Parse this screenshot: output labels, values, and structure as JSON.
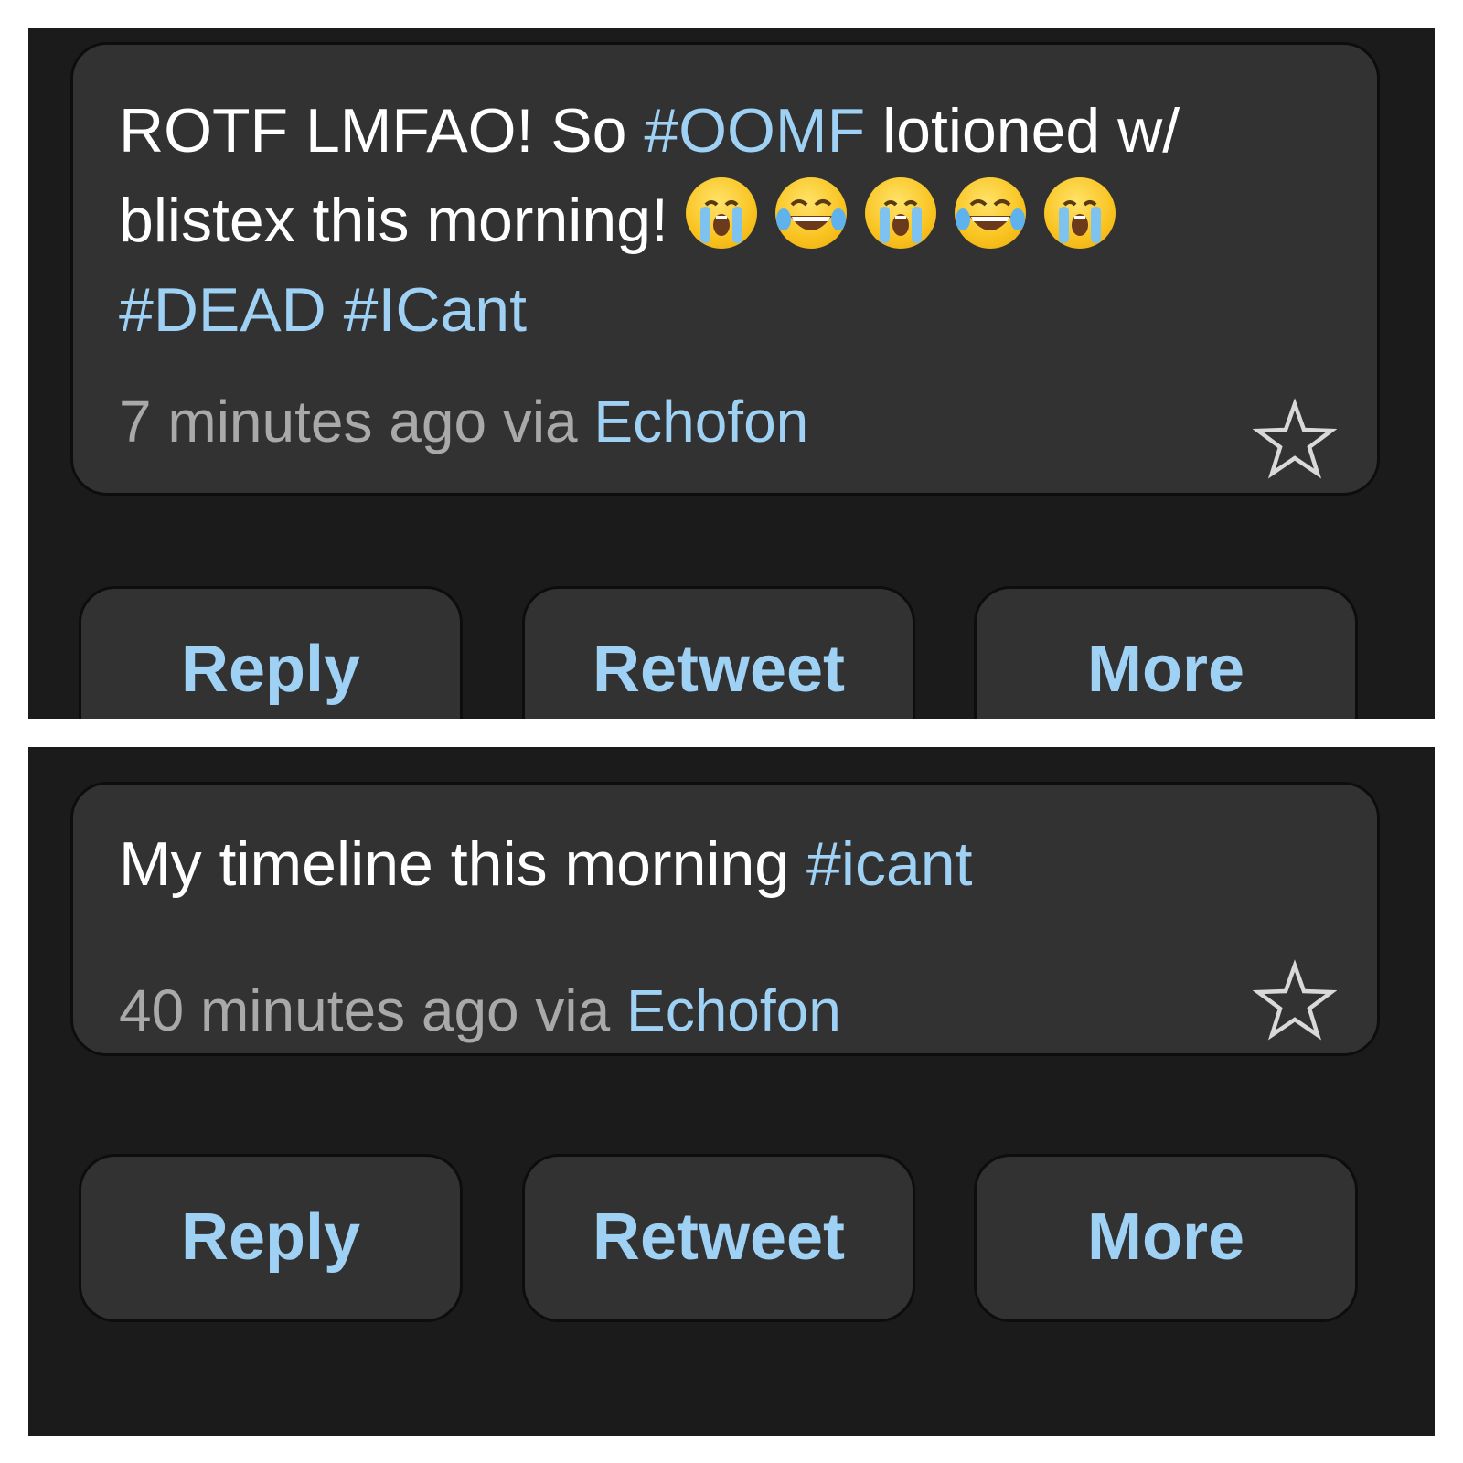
{
  "tweets": [
    {
      "text_parts": {
        "p1": "ROTF LMFAO! So ",
        "h1": "#OOMF",
        "p2": " lotioned w/ blistex this morning! ",
        "h2": "#DEAD",
        "sp": " ",
        "h3": "#ICant"
      },
      "emojis": [
        "loudly-crying-face",
        "face-with-tears-of-joy",
        "loudly-crying-face",
        "face-with-tears-of-joy",
        "loudly-crying-face"
      ],
      "time": "7 minutes ago",
      "via": " via ",
      "source": "Echofon",
      "starred": false
    },
    {
      "text_parts": {
        "p1": "My timeline this morning ",
        "h1": "#icant"
      },
      "time": "40 minutes ago",
      "via": " via ",
      "source": "Echofon",
      "starred": false
    }
  ],
  "actions": {
    "reply": "Reply",
    "retweet": "Retweet",
    "more": "More"
  },
  "colors": {
    "background": "#1b1b1b",
    "card": "#323232",
    "text": "#ffffff",
    "muted": "#a9a9a9",
    "accent": "#9fd1f5"
  }
}
